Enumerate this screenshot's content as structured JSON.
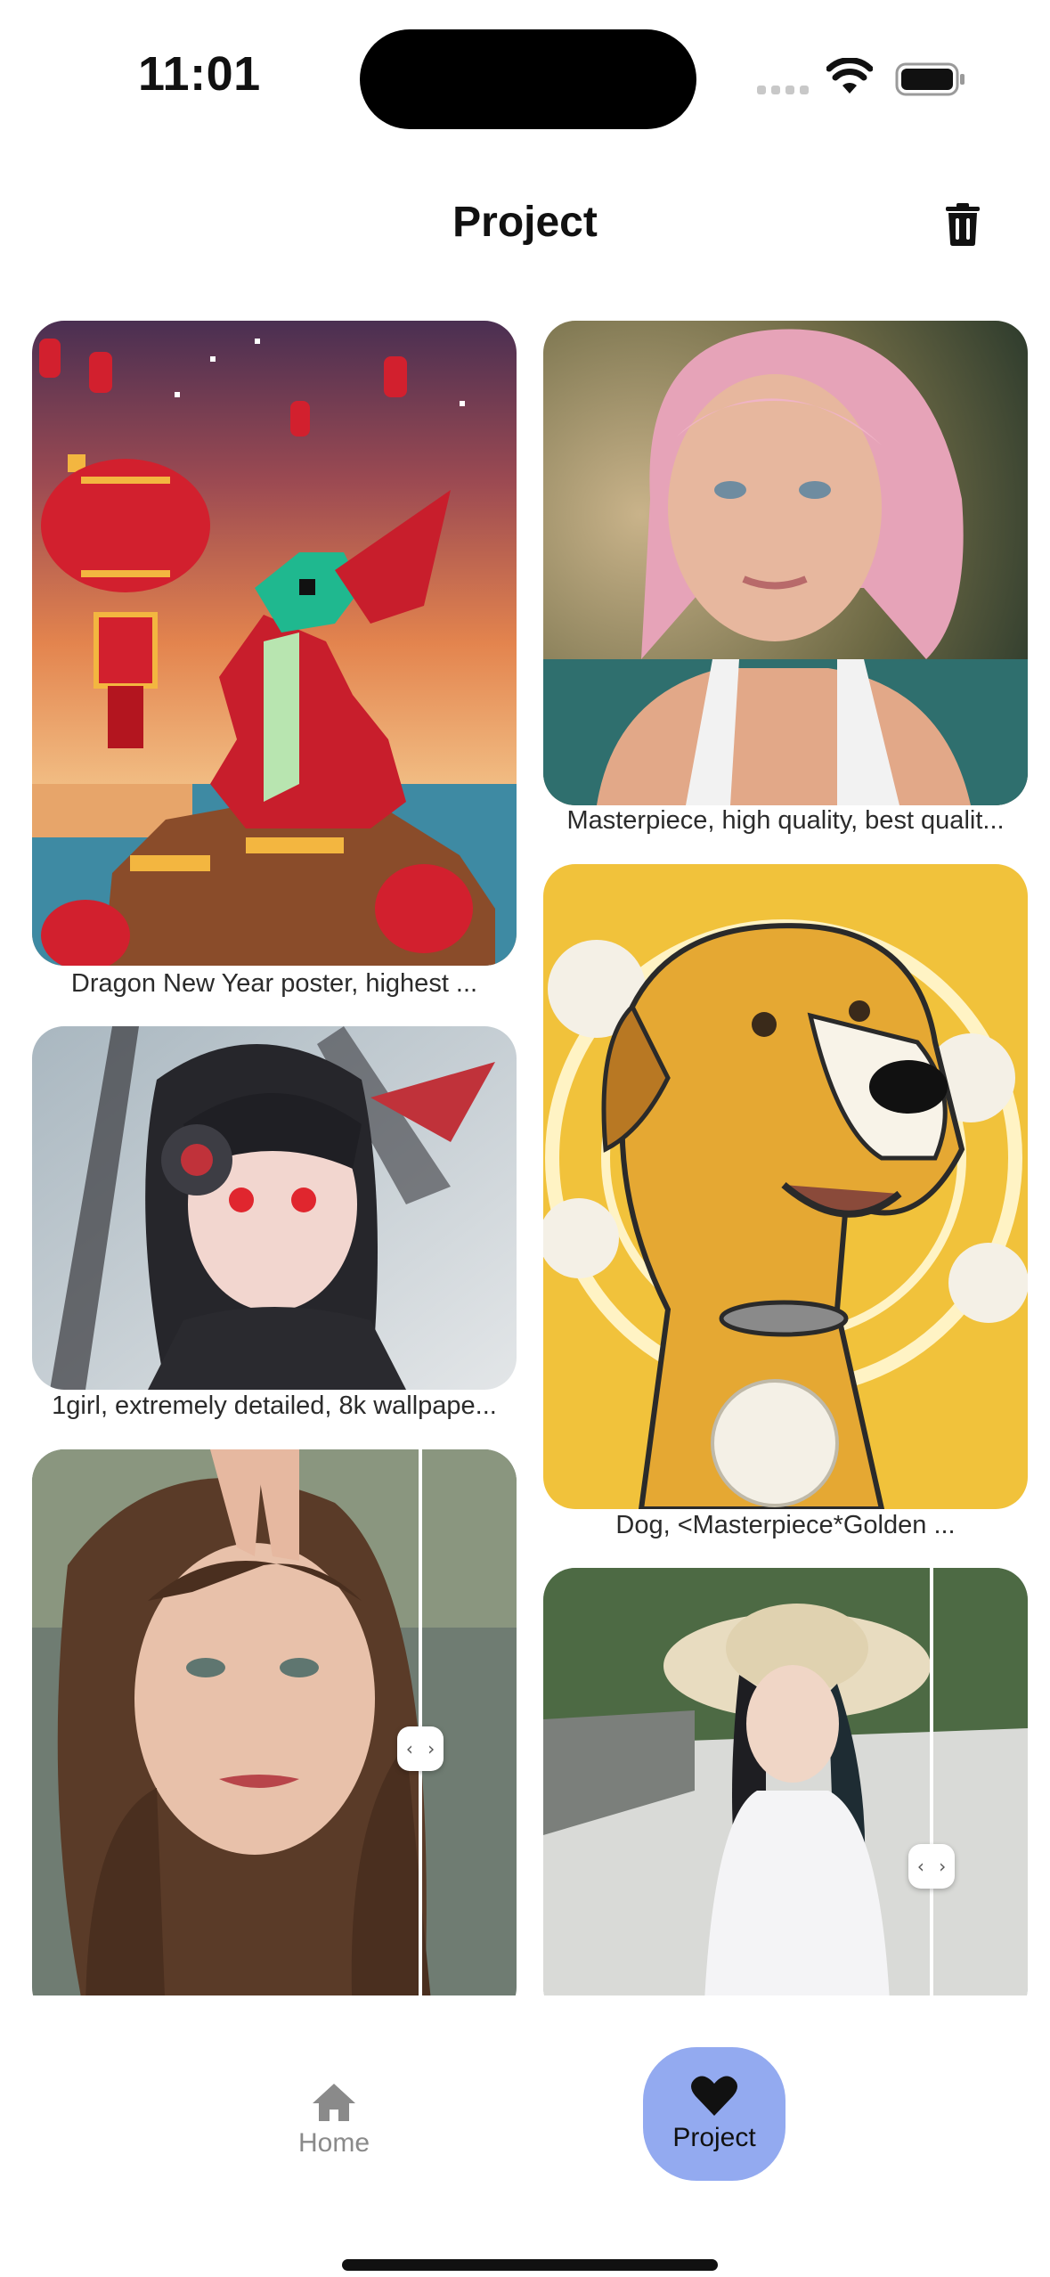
{
  "status": {
    "time": "11:01"
  },
  "header": {
    "title": "Project"
  },
  "cards": [
    {
      "caption": "Dragon New Year poster, highest ..."
    },
    {
      "caption": "Masterpiece, high quality, best qualit..."
    },
    {
      "caption": "1girl, extremely detailed, 8k wallpape..."
    },
    {
      "caption": "Dog, <Masterpiece*Golden ..."
    },
    {
      "caption": ""
    },
    {
      "caption": ""
    }
  ],
  "compare_handle": "‹ ›",
  "tabs": {
    "home": "Home",
    "project": "Project"
  },
  "colors": {
    "accent": "#93aaf0",
    "text": "#111111",
    "muted": "#8a8a8a"
  }
}
